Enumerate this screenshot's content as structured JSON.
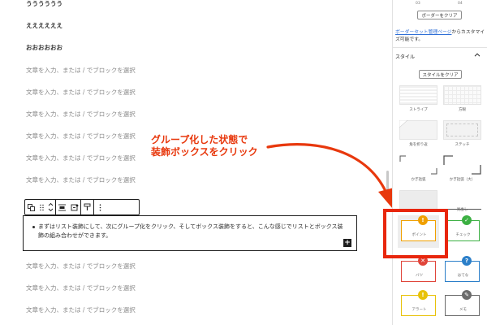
{
  "editor": {
    "paragraphs": [
      "うううううう",
      "ええええええ",
      "おおおおおお",
      "文章を入力、または / でブロックを選択",
      "文章を入力、または / でブロックを選択",
      "文章を入力、または / でブロックを選択",
      "文章を入力、または / でブロックを選択",
      "文章を入力、または / でブロックを選択",
      "文章を入力、または / でブロックを選択",
      "文章を入力、または / でブロックを選択",
      "文章を入力、または / でブロックを選択",
      "文章を入力、または / でブロックを選択",
      "文章を入力、または / でブロックを選択"
    ],
    "group_block_text": "まずはリスト装飾にして、次にグループ化をクリック、そしてボックス装飾をすると、こんな感じでリストとボックス装飾の組み合わせができます。",
    "inserter_label": "+"
  },
  "toolbar": {
    "buttons": [
      {
        "icon": "group-icon"
      },
      {
        "icon": "drag-handle-icon"
      },
      {
        "icon": "move-up-down-icon"
      },
      {
        "icon": "align-icon"
      },
      {
        "icon": "full-width-icon"
      },
      {
        "icon": "highlight-icon"
      },
      {
        "icon": "more-options-icon"
      }
    ]
  },
  "annotation": {
    "line1": "グループ化した状態で",
    "line2": "装飾ボックスをクリック",
    "color": "#e8380d"
  },
  "sidebar": {
    "grid_labels": [
      "03",
      "04"
    ],
    "border_clear_label": "ボーダーをクリア",
    "preset_link": "ボーダーセット管理ページ",
    "preset_note": "からカスタマイズ可能です。",
    "style_section_title": "スタイル",
    "style_clear_label": "スタイルをクリア",
    "style_tiles": [
      {
        "label": "ストライプ",
        "icon": "stripe-pattern"
      },
      {
        "label": "方眼",
        "icon": "grid-pattern"
      },
      {
        "label": "角を折り返",
        "icon": "folded-corner"
      },
      {
        "label": "ステッチ",
        "icon": "stitch-border"
      },
      {
        "label": "かぎ括弧",
        "icon": "bracket-corner"
      },
      {
        "label": "かぎ括弧（大）",
        "icon": "bracket-corner-large"
      },
      {
        "label": "",
        "icon": "gray-fill"
      },
      {
        "label": "見出し",
        "icon": "heading-line"
      }
    ],
    "deco_tiles": [
      {
        "label": "ポイント",
        "badge": "!",
        "color": "#f0a000"
      },
      {
        "label": "チェック",
        "badge": "✓",
        "color": "#3cb043"
      },
      {
        "label": "バツ",
        "badge": "✕",
        "color": "#e0453a"
      },
      {
        "label": "はてな",
        "badge": "?",
        "color": "#2b7fc9"
      },
      {
        "label": "アラート",
        "badge": "!",
        "color": "#e8c20a"
      },
      {
        "label": "メモ",
        "badge": "✎",
        "color": "#6b6b6b"
      }
    ]
  },
  "highlight_color": "#e8260d"
}
